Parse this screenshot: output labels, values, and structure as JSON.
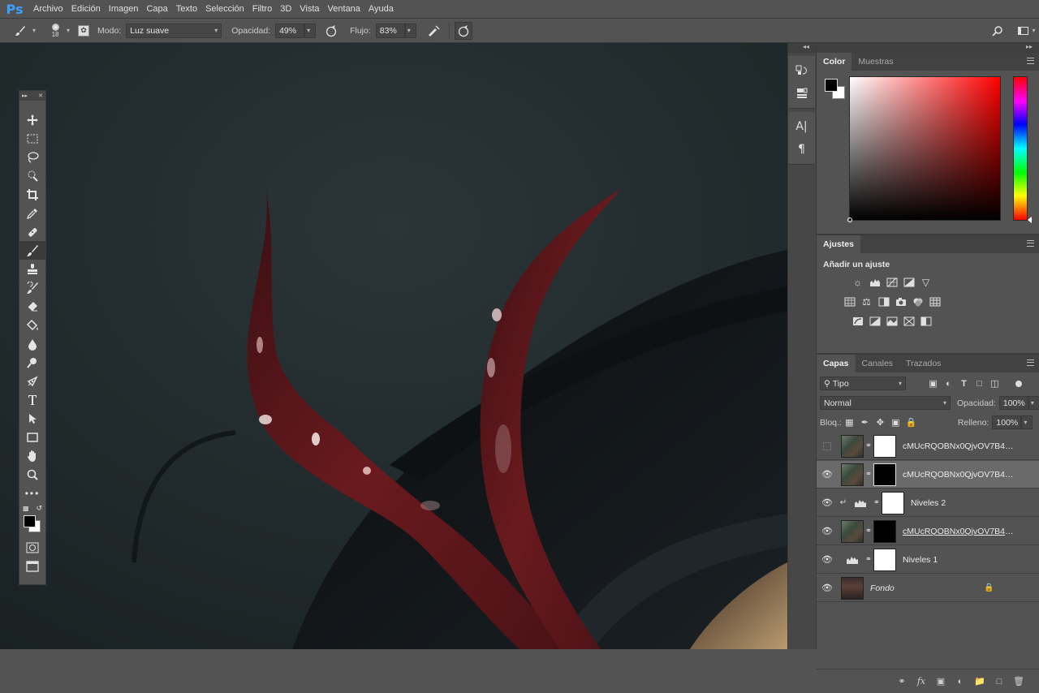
{
  "app": {
    "logo": "Ps"
  },
  "menu": [
    "Archivo",
    "Edición",
    "Imagen",
    "Capa",
    "Texto",
    "Selección",
    "Filtro",
    "3D",
    "Vista",
    "Ventana",
    "Ayuda"
  ],
  "options": {
    "brush_size": "18",
    "mode_label": "Modo:",
    "mode_value": "Luz suave",
    "opacity_label": "Opacidad:",
    "opacity_value": "49%",
    "flow_label": "Flujo:",
    "flow_value": "83%"
  },
  "color_panel": {
    "tabs": [
      "Color",
      "Muestras"
    ],
    "foreground": "#000000",
    "background": "#ffffff"
  },
  "adjustments_panel": {
    "tab": "Ajustes",
    "title": "Añadir un ajuste"
  },
  "layers_panel": {
    "tabs": [
      "Capas",
      "Canales",
      "Trazados"
    ],
    "filter_label": "Tipo",
    "blend_mode": "Normal",
    "opacity_label": "Opacidad:",
    "opacity_value": "100%",
    "lock_label": "Bloq.:",
    "fill_label": "Relleno:",
    "fill_value": "100%",
    "layers": [
      {
        "name": "cMUcRQOBNx0QjvOV7B4X-...",
        "visible": false,
        "mask": "white"
      },
      {
        "name": "cMUcRQOBNx0QjvOV7B4X-...",
        "visible": true,
        "mask": "black",
        "selected": true
      },
      {
        "name": "Niveles 2",
        "visible": true,
        "mask": "white",
        "clipped": true
      },
      {
        "name": "cMUcRQOBNx0QjvOV7B4X-...",
        "visible": true,
        "mask": "black"
      },
      {
        "name": "Niveles 1",
        "visible": true,
        "mask": "white"
      },
      {
        "name": "Fondo",
        "visible": true,
        "locked": true
      }
    ]
  }
}
